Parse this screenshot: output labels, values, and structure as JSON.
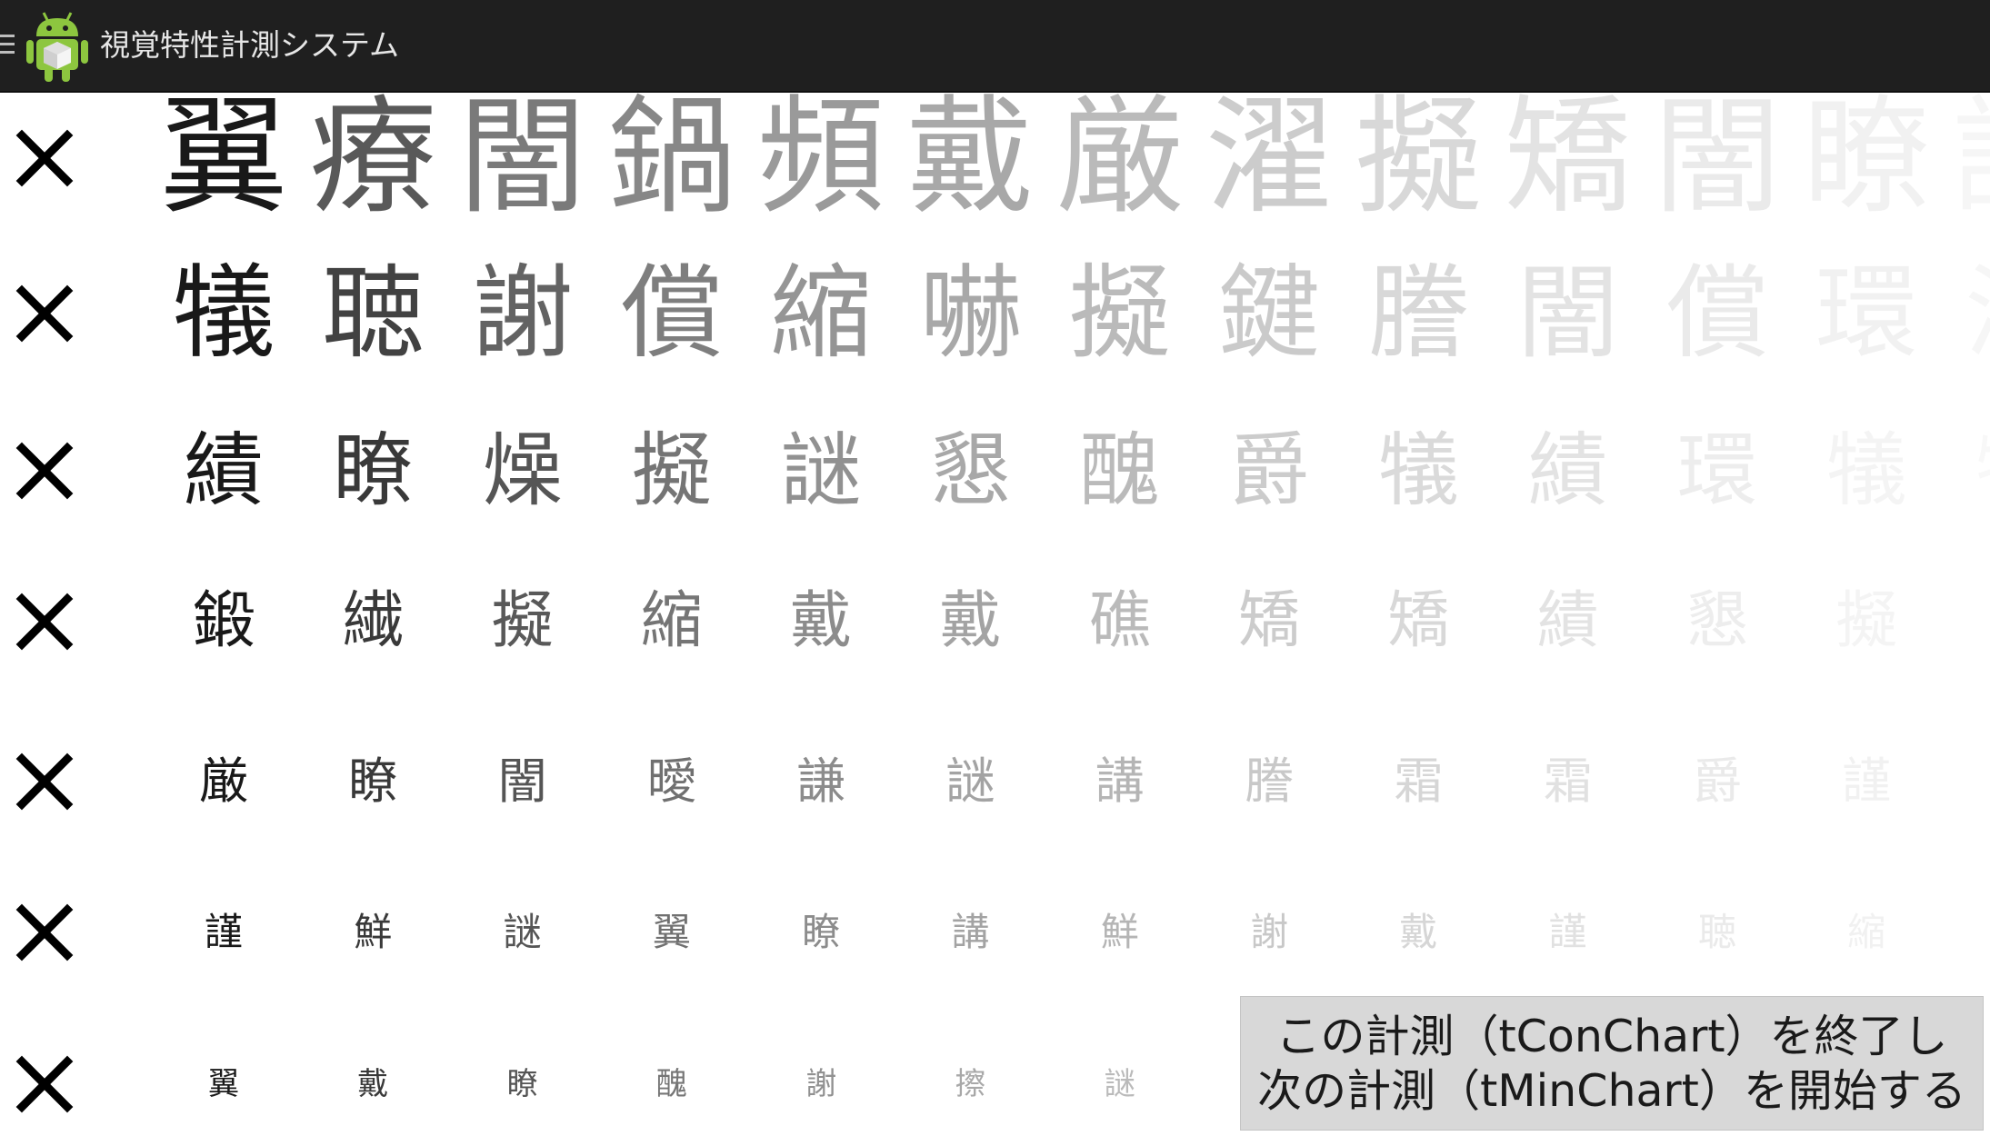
{
  "app": {
    "title": "視覚特性計測システム",
    "icons": {
      "menu": "hamburger-menu-icon",
      "app": "android-robot-icon"
    }
  },
  "mark_icon": "x-mark-icon",
  "rows": [
    {
      "font_size": 140,
      "chars": [
        "翼",
        "療",
        "闇",
        "鍋",
        "頻",
        "戴",
        "厳",
        "濯",
        "擬",
        "矯",
        "闇",
        "瞭",
        "詳"
      ],
      "levels": [
        1.0,
        0.72,
        0.58,
        0.52,
        0.44,
        0.38,
        0.3,
        0.22,
        0.17,
        0.12,
        0.09,
        0.06,
        0.04
      ]
    },
    {
      "font_size": 112,
      "chars": [
        "犠",
        "聴",
        "謝",
        "償",
        "縮",
        "嚇",
        "擬",
        "鍵",
        "謄",
        "闇",
        "償",
        "環",
        "濯"
      ],
      "levels": [
        1.0,
        0.82,
        0.68,
        0.56,
        0.46,
        0.38,
        0.3,
        0.23,
        0.17,
        0.12,
        0.09,
        0.06,
        0.04
      ]
    },
    {
      "font_size": 88,
      "chars": [
        "績",
        "瞭",
        "燥",
        "擬",
        "謎",
        "懇",
        "醜",
        "爵",
        "犠",
        "績",
        "環",
        "犠",
        "犠"
      ],
      "levels": [
        1.0,
        0.86,
        0.74,
        0.6,
        0.48,
        0.38,
        0.3,
        0.22,
        0.16,
        0.12,
        0.08,
        0.05,
        0.03
      ]
    },
    {
      "font_size": 68,
      "chars": [
        "鍛",
        "繊",
        "擬",
        "縮",
        "戴",
        "戴",
        "礁",
        "矯",
        "矯",
        "績",
        "懇",
        "擬"
      ],
      "levels": [
        1.0,
        0.86,
        0.72,
        0.6,
        0.5,
        0.4,
        0.3,
        0.22,
        0.17,
        0.12,
        0.08,
        0.05
      ]
    },
    {
      "font_size": 54,
      "chars": [
        "厳",
        "瞭",
        "闇",
        "曖",
        "謙",
        "謎",
        "講",
        "謄",
        "霜",
        "霜",
        "爵",
        "謹"
      ],
      "levels": [
        1.0,
        0.86,
        0.74,
        0.62,
        0.5,
        0.4,
        0.32,
        0.24,
        0.18,
        0.13,
        0.09,
        0.06
      ]
    },
    {
      "font_size": 42,
      "chars": [
        "謹",
        "鮮",
        "謎",
        "翼",
        "瞭",
        "講",
        "鮮",
        "謝",
        "戴",
        "謹",
        "聴",
        "縮"
      ],
      "levels": [
        1.0,
        0.86,
        0.74,
        0.62,
        0.5,
        0.4,
        0.32,
        0.24,
        0.18,
        0.13,
        0.09,
        0.06
      ]
    },
    {
      "font_size": 34,
      "chars": [
        "翼",
        "戴",
        "瞭",
        "醜",
        "謝",
        "擦",
        "謎"
      ],
      "levels": [
        1.0,
        0.86,
        0.74,
        0.6,
        0.48,
        0.38,
        0.3
      ]
    }
  ],
  "finish_button": {
    "line1": "この計測（tConChart）を終了し",
    "line2": "次の計測（tMinChart）を開始する"
  }
}
